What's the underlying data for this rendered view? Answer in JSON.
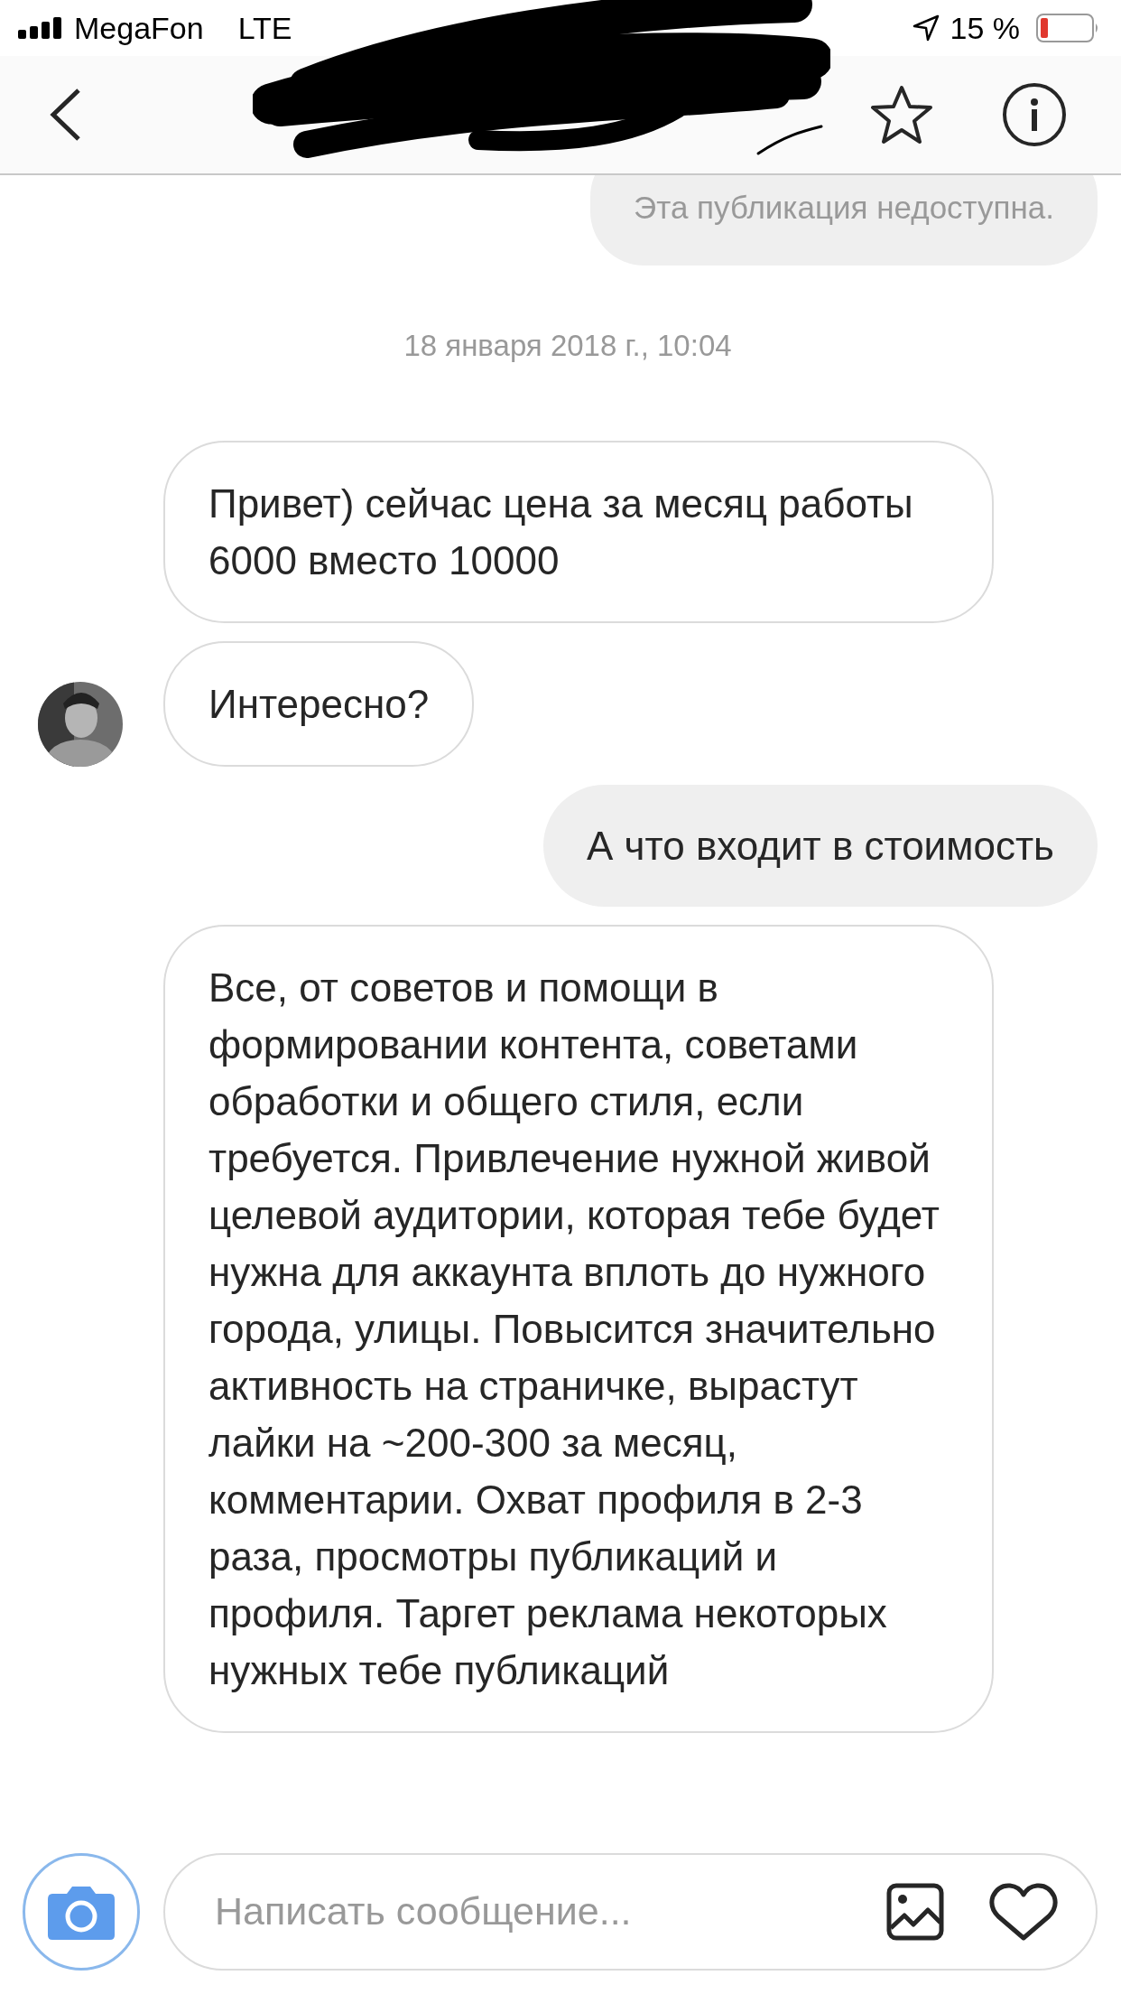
{
  "status_bar": {
    "carrier": "MegaFon",
    "network": "LTE",
    "battery": "15 %"
  },
  "messages": [
    {
      "kind": "unavailable",
      "text": "Эта публикация недоступна."
    },
    {
      "kind": "timestamp",
      "text": "18 января 2018 г., 10:04"
    },
    {
      "kind": "incoming",
      "text": "Привет) сейчас цена за месяц работы 6000 вместо 10000",
      "avatar": false
    },
    {
      "kind": "incoming",
      "text": "Интересно?",
      "avatar": true
    },
    {
      "kind": "outgoing",
      "text": "А что входит в стоимость"
    },
    {
      "kind": "incoming",
      "text": "Все, от советов и помощи в формировании контента, советами обработки и общего стиля, если требуется. Привлечение нужной живой целевой аудитории, которая тебе будет нужна для аккаунта вплоть до нужного города, улицы. Повысится значительно активность на страничке, вырастут лайки на ~200-300 за месяц, комментарии.  Охват профиля в 2-3 раза, просмотры публикаций и профиля. Таргет реклама некоторых нужных тебе публикаций",
      "avatar": false
    }
  ],
  "composer": {
    "placeholder": "Написать сообщение..."
  }
}
